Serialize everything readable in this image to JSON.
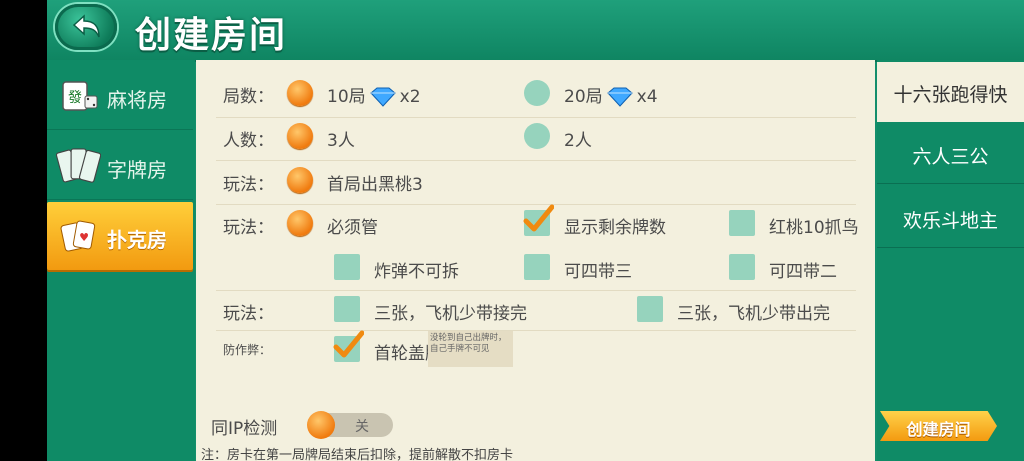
{
  "header": {
    "title": "创建房间"
  },
  "leftnav": [
    {
      "label": "麻将房",
      "icon": "mahjong-tile-icon"
    },
    {
      "label": "字牌房",
      "icon": "word-card-icon"
    },
    {
      "label": "扑克房",
      "icon": "poker-card-icon",
      "active": true
    }
  ],
  "rows": {
    "rounds": {
      "label": "局数：",
      "opt1": "10局",
      "opt1_mult": "x2",
      "opt2": "20局",
      "opt2_mult": "x4"
    },
    "players": {
      "label": "人数：",
      "opt1": "3人",
      "opt2": "2人"
    },
    "play1": {
      "label": "玩法：",
      "opt1": "首局出黑桃3"
    },
    "play2": {
      "label": "玩法：",
      "opt1": "必须管",
      "opt2": "显示剩余牌数",
      "opt3": "红桃10抓鸟",
      "opt4": "炸弹不可拆",
      "opt5": "可四带三",
      "opt6": "可四带二"
    },
    "play3": {
      "label": "玩法：",
      "opt1": "三张，飞机少带接完",
      "opt2": "三张，飞机少带出完"
    },
    "anticheat": {
      "label": "防作弊：",
      "opt1": "首轮盖牌",
      "tip": "没轮到自己出牌时，自己手牌不可见"
    }
  },
  "same_ip": {
    "label": "同IP检测",
    "toggle_text": "关"
  },
  "note": "注：房卡在第一局牌局结束后扣除，提前解散不扣房卡",
  "rightnav": [
    {
      "label": "十六张跑得快",
      "active": true
    },
    {
      "label": "六人三公"
    },
    {
      "label": "欢乐斗地主"
    }
  ],
  "create_button": "创建房间",
  "colors": {
    "green": "#138e6b",
    "orange": "#f07b0f",
    "panel": "#f3f0de",
    "off": "#96d3bd"
  }
}
